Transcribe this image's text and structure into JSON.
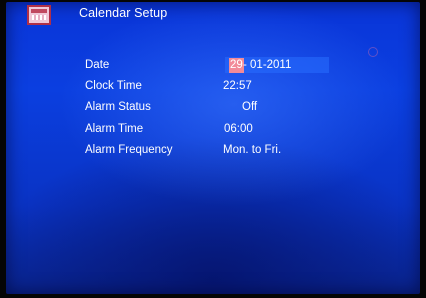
{
  "header": {
    "title": "Calendar Setup",
    "icon": "calendar-icon"
  },
  "settings": [
    {
      "label": "Date",
      "value_day": "29",
      "value_rest": "- 01-2011",
      "selected": true
    },
    {
      "label": "Clock Time",
      "value": "22:57"
    },
    {
      "label": "Alarm Status",
      "value": "Off"
    },
    {
      "label": "Alarm Time",
      "value": "06:00"
    },
    {
      "label": "Alarm Frequency",
      "value": "Mon. to Fri."
    }
  ],
  "colors": {
    "background": "#0b3fe0",
    "highlight": "#f28a98",
    "text": "#ffffff"
  }
}
